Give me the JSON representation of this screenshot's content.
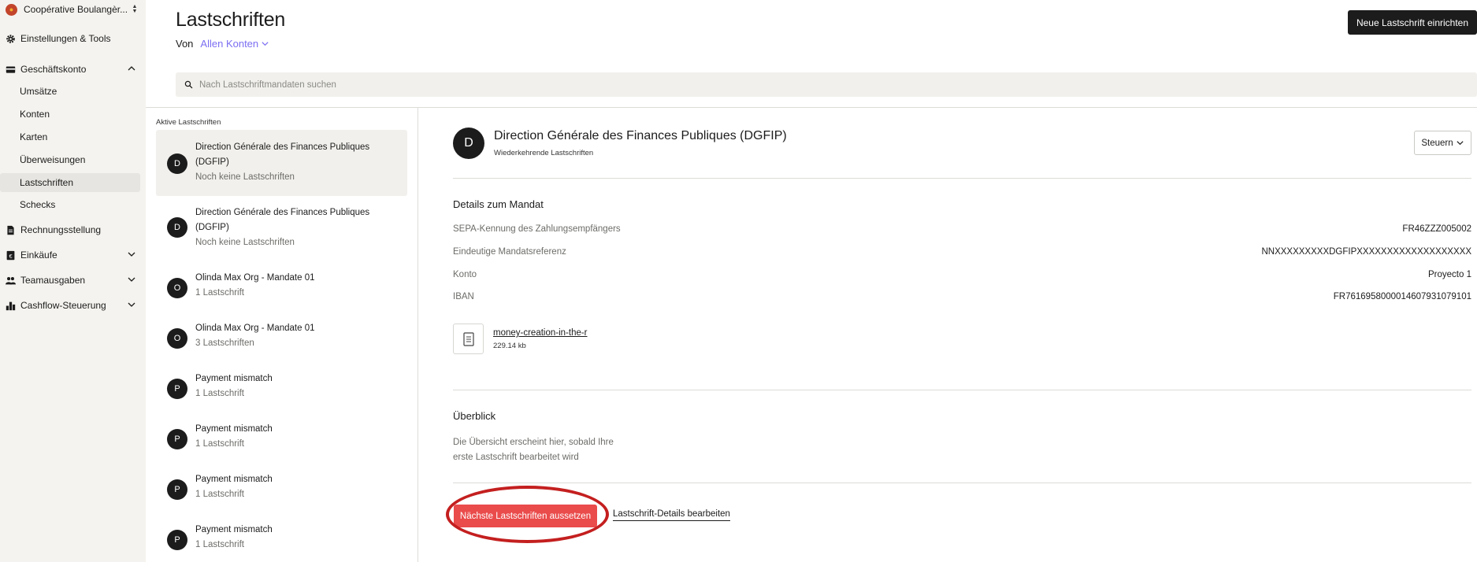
{
  "sidebar": {
    "org_name": "Coopérative Boulangèr...",
    "items": [
      {
        "label": "Einstellungen & Tools",
        "icon": "gear-icon"
      },
      {
        "label": "Geschäftskonto",
        "icon": "wallet-icon"
      },
      {
        "label": "Rechnungsstellung",
        "icon": "document-icon"
      },
      {
        "label": "Einkäufe",
        "icon": "receipt-icon"
      },
      {
        "label": "Teamausgaben",
        "icon": "team-icon"
      },
      {
        "label": "Cashflow-Steuerung",
        "icon": "bar-chart-icon"
      }
    ],
    "sub_items": [
      {
        "label": "Umsätze"
      },
      {
        "label": "Konten"
      },
      {
        "label": "Karten"
      },
      {
        "label": "Überweisungen"
      },
      {
        "label": "Lastschriften"
      },
      {
        "label": "Schecks"
      }
    ]
  },
  "header": {
    "title": "Lastschriften",
    "from_label": "Von",
    "account_filter": "Allen Konten",
    "new_button": "Neue Lastschrift einrichten"
  },
  "search": {
    "placeholder": "Nach Lastschriftmandaten suchen"
  },
  "list": {
    "heading": "Aktive Lastschriften",
    "items": [
      {
        "initial": "D",
        "name": "Direction Générale des Finances Publiques (DGFIP)",
        "sub": "Noch keine Lastschriften"
      },
      {
        "initial": "D",
        "name": "Direction Générale des Finances Publiques (DGFIP)",
        "sub": "Noch keine Lastschriften"
      },
      {
        "initial": "O",
        "name": "Olinda Max Org - Mandate 01",
        "sub": "1 Lastschrift"
      },
      {
        "initial": "O",
        "name": "Olinda Max Org - Mandate 01",
        "sub": "3 Lastschriften"
      },
      {
        "initial": "P",
        "name": "Payment mismatch",
        "sub": "1 Lastschrift"
      },
      {
        "initial": "P",
        "name": "Payment mismatch",
        "sub": "1 Lastschrift"
      },
      {
        "initial": "P",
        "name": "Payment mismatch",
        "sub": "1 Lastschrift"
      },
      {
        "initial": "P",
        "name": "Payment mismatch",
        "sub": "1 Lastschrift"
      }
    ]
  },
  "detail": {
    "initial": "D",
    "name": "Direction Générale des Finances Publiques (DGFIP)",
    "subtitle": "Wiederkehrende Lastschriften",
    "steuern_button": "Steuern",
    "mandate_title": "Details zum Mandat",
    "fields": [
      {
        "key": "SEPA-Kennung des Zahlungsempfängers",
        "value": "FR46ZZZ005002"
      },
      {
        "key": "Eindeutige Mandatsreferenz",
        "value": "NNXXXXXXXXXDGFIPXXXXXXXXXXXXXXXXXXX"
      },
      {
        "key": "Konto",
        "value": "Proyecto 1"
      },
      {
        "key": "IBAN",
        "value": "FR7616958000014607931079101"
      }
    ],
    "attachment": {
      "name": "money-creation-in-the-r",
      "size": "229.14 kb"
    },
    "overview_title": "Überblick",
    "overview_text": "Die Übersicht erscheint hier, sobald Ihre erste Lastschrift bearbeitet wird",
    "pause_button": "Nächste Lastschriften aussetzen",
    "edit_link": "Lastschrift-Details bearbeiten"
  },
  "colors": {
    "accent": "#7b6ef2",
    "danger": "#ea4b4b",
    "highlight_ring": "#c41f1f",
    "dark": "#1c1c1c",
    "sidebar_bg": "#f4f3ef"
  }
}
